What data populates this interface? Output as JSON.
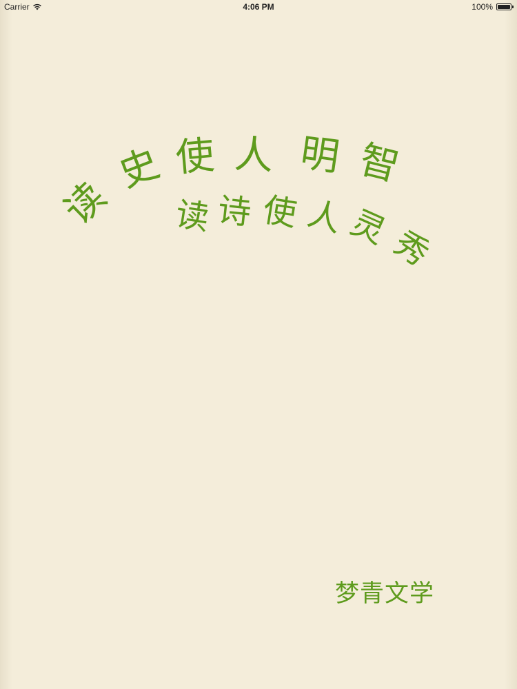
{
  "status_bar": {
    "carrier": "Carrier",
    "time": "4:06 PM",
    "battery": "100%",
    "battery_level": 1.0,
    "signal_icon": "wifi-icon",
    "battery_icon": "battery-icon"
  },
  "cover": {
    "line1": [
      "读",
      "史",
      "使",
      "人",
      "明",
      "智"
    ],
    "line2": [
      "读",
      "诗",
      "使",
      "人",
      "灵",
      "秀"
    ],
    "signature": "梦青文学",
    "text_color": "#5e9b1d",
    "background_color": "#f4edda"
  }
}
